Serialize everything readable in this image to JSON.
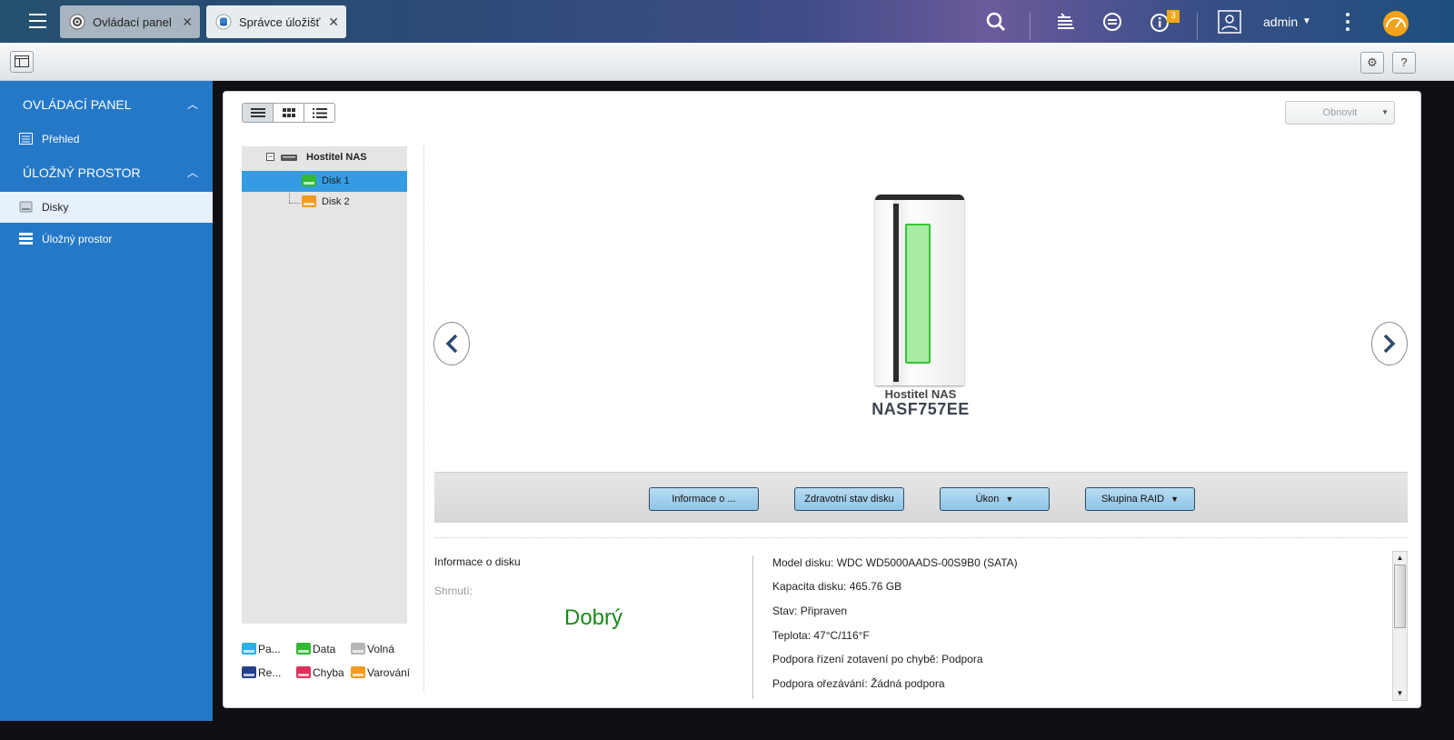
{
  "tabs": [
    {
      "label": "Ovládací panel",
      "icon": "gear-icon"
    },
    {
      "label": "Správce úložišť",
      "icon": "storage-icon"
    }
  ],
  "topbar": {
    "user": "admin",
    "notification_count": "3"
  },
  "sidebar": {
    "sections": [
      {
        "title": "OVLÁDACÍ PANEL",
        "items": [
          {
            "label": "Přehled"
          }
        ]
      },
      {
        "title": "ÚLOŽNÝ PROSTOR",
        "items": [
          {
            "label": "Disky"
          },
          {
            "label": "Úložný prostor"
          }
        ]
      }
    ]
  },
  "main": {
    "refresh_label": "Obnovit",
    "tree": {
      "root": "Hostitel NAS",
      "disks": [
        "Disk 1",
        "Disk 2"
      ]
    },
    "legend": [
      {
        "label": "Pa...",
        "color": "#2ab0e5"
      },
      {
        "label": "Data",
        "color": "#32b832"
      },
      {
        "label": "Volná",
        "color": "#b5b5b5"
      },
      {
        "label": "Re...",
        "color": "#243f8a"
      },
      {
        "label": "Chyba",
        "color": "#e0305a"
      },
      {
        "label": "Varování",
        "color": "#f09a1e"
      }
    ],
    "device": {
      "title": "Hostitel NAS",
      "name": "NASF757EE"
    },
    "actions": [
      "Informace o ...",
      "Zdravotní stav disku",
      "Úkon",
      "Skupina RAID"
    ],
    "info": {
      "heading": "Informace o disku",
      "summary_label": "Shrnutí:",
      "summary_value": "Dobrý",
      "details": [
        {
          "label": "Model disku:",
          "value": "WDC WD5000AADS-00S9B0 (SATA)"
        },
        {
          "label": "Kapacita disku:",
          "value": "465.76 GB"
        },
        {
          "label": "Stav:",
          "value": "Připraven"
        },
        {
          "label": "Teplota:",
          "value": "47°C/116°F"
        },
        {
          "label": "Podpora řízení zotavení po chybě:",
          "value": "Podpora"
        },
        {
          "label": "Podpora ořezávání:",
          "value": "Žádná podpora"
        }
      ]
    }
  }
}
